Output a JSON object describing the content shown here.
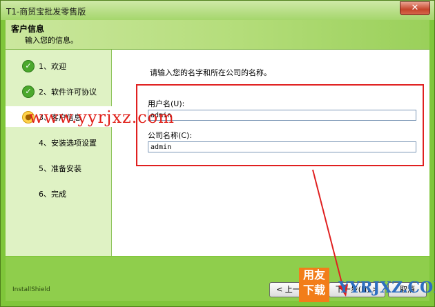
{
  "window": {
    "title": "T1-商贸宝批发零售版",
    "close_glyph": "✕"
  },
  "header": {
    "title": "客户信息",
    "subtitle": "输入您的信息。"
  },
  "steps": [
    {
      "label": "1、欢迎",
      "state": "done"
    },
    {
      "label": "2、软件许可协议",
      "state": "done"
    },
    {
      "label": "3、客户信息",
      "state": "current"
    },
    {
      "label": "4、安装选项设置",
      "state": "pending"
    },
    {
      "label": "5、准备安装",
      "state": "pending"
    },
    {
      "label": "6、完成",
      "state": "pending"
    }
  ],
  "icons": {
    "done": "check-circle-icon",
    "current": "sun-icon"
  },
  "main": {
    "prompt": "请输入您的名字和所在公司的名称。",
    "username_label": "用户名(U):",
    "username_value": "admin",
    "company_label": "公司名称(C):",
    "company_value": "admin"
  },
  "footer": {
    "brand": "InstallShield",
    "back_button": "< 上一步(B)",
    "next_button": "下一步(N) >",
    "cancel_button": "取消"
  },
  "overlays": {
    "watermark_text": "www.yyrjxz.com",
    "logo_text_1": "用友",
    "logo_text_2": "下载",
    "logo2_text": "YYRJXZ.COM"
  },
  "colors": {
    "highlight_box": "#e02020",
    "window_accent": "#7fc63a"
  }
}
